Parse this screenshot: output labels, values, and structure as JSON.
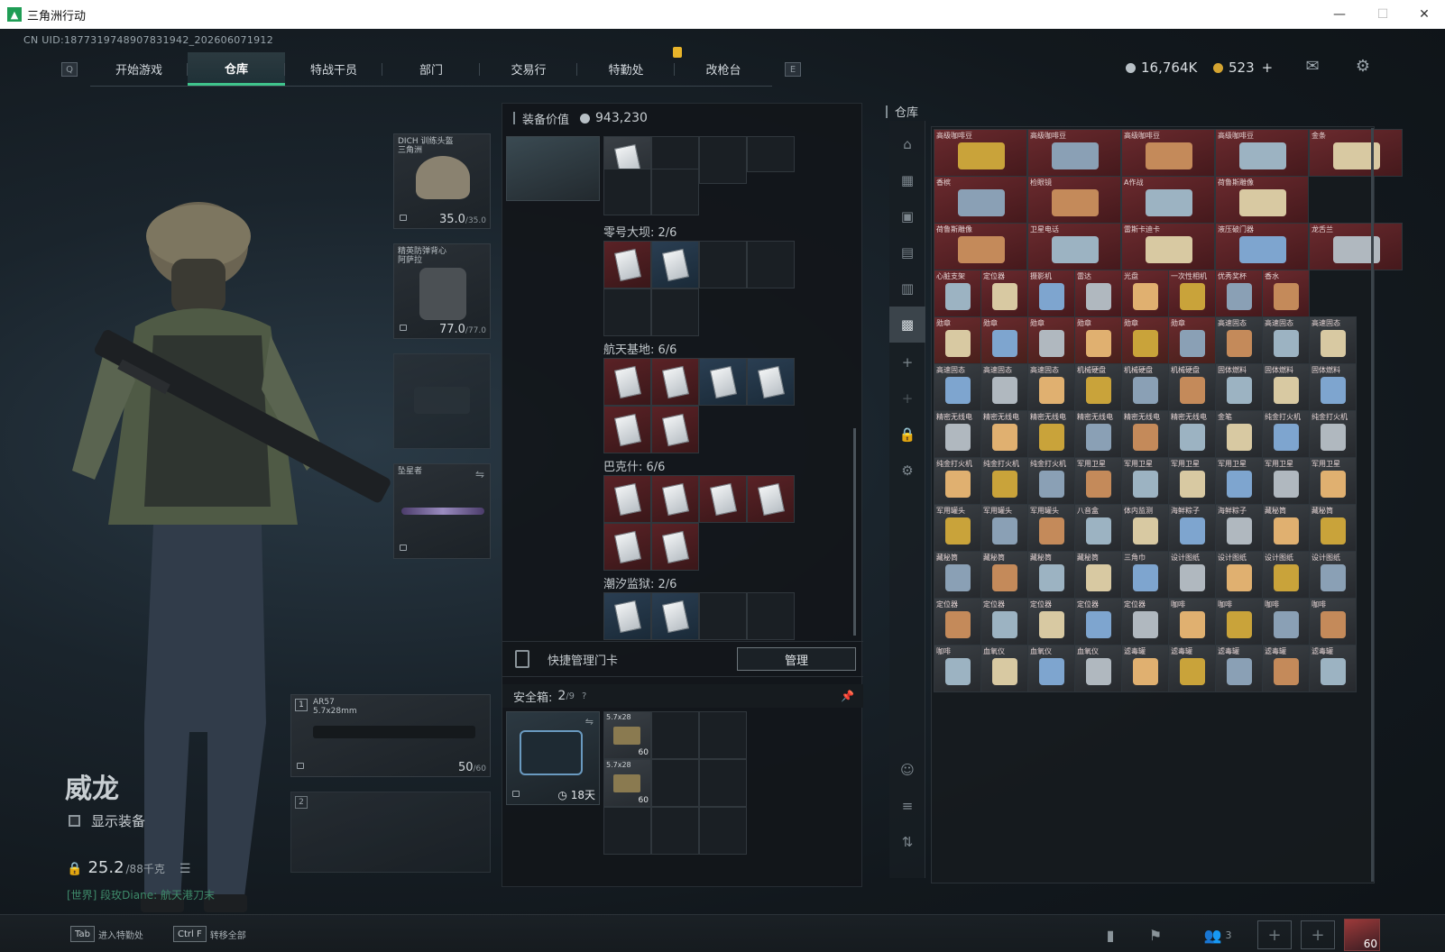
{
  "window": {
    "title": "三角洲行动",
    "controls": [
      "—",
      "☐",
      "✕"
    ]
  },
  "uid": "CN UID:1877319748907831942_202606071912",
  "nav": {
    "left_key": "Q",
    "right_key": "E",
    "tabs": [
      "开始游戏",
      "仓库",
      "特战干员",
      "部门",
      "交易行",
      "特勤处",
      "改枪台"
    ],
    "active_tab": "仓库"
  },
  "currency": {
    "silver": "16,764K",
    "gold": "523",
    "gold_plus": "+"
  },
  "character": {
    "name": "威龙",
    "show_equipment": "显示装备",
    "weight": "25.2",
    "weight_max": "/88千克",
    "chat": "[世界] 段玫Diane: 航天港刀末"
  },
  "equipment": {
    "helmet": {
      "label": "DICH 训练头盔\n三角洲",
      "durability": "35.0",
      "durability_max": "/35.0"
    },
    "armor": {
      "label": "精英防弹背心\n阿萨拉",
      "durability": "77.0",
      "durability_max": "/77.0"
    },
    "melee": {
      "label": "坠星者"
    },
    "primary": {
      "index": "1",
      "name": "AR57",
      "caliber": "5.7x28mm",
      "ammo": "50",
      "ammo_max": "/60"
    },
    "secondary": {
      "index": "2"
    }
  },
  "keycard_panel": {
    "title": "装备价值",
    "value": "943,230",
    "groups": [
      {
        "name": "零号大坝: 2/6"
      },
      {
        "name": "航天基地: 6/6"
      },
      {
        "name": "巴克什: 6/6"
      },
      {
        "name": "潮汐监狱: 2/6"
      }
    ],
    "quick_manage": "快捷管理门卡",
    "manage_button": "管理"
  },
  "safe_box": {
    "label": "安全箱:",
    "count": "2",
    "count_max": "/9",
    "help": "?",
    "timer": "18天",
    "ammo": [
      {
        "name": "5.7x28",
        "count": "60"
      },
      {
        "name": "5.7x28",
        "count": "60"
      }
    ]
  },
  "warehouse": {
    "title": "仓库",
    "rows": [
      [
        "高级咖啡豆",
        "高级咖啡豆",
        "高级咖啡豆",
        "高级咖啡豆",
        "金条"
      ],
      [
        "香槟",
        "检眼镜",
        "A作战",
        "荷鲁斯雕像"
      ],
      [
        "荷鲁斯雕像",
        "卫星电话",
        "雷斯卡迪卡",
        "液压破门器",
        "龙舌兰"
      ],
      [
        "心脏支架",
        "定位器",
        "摄影机",
        "雷达",
        "光盘",
        "一次性相机",
        "优秀奖杯",
        "香水"
      ],
      [
        "勋章",
        "勋章",
        "勋章",
        "勋章",
        "勋章",
        "勋章",
        "高速固态",
        "高速固态",
        "高速固态"
      ],
      [
        "高速固态",
        "高速固态",
        "高速固态",
        "机械硬盘",
        "机械硬盘",
        "机械硬盘",
        "固体燃料",
        "固体燃料",
        "固体燃料"
      ],
      [
        "精密无线电",
        "精密无线电",
        "精密无线电",
        "精密无线电",
        "精密无线电",
        "精密无线电",
        "金笔",
        "纯金打火机",
        "纯金打火机"
      ],
      [
        "纯金打火机",
        "纯金打火机",
        "纯金打火机",
        "军用卫星",
        "军用卫星",
        "军用卫星",
        "军用卫星",
        "军用卫星",
        "军用卫星"
      ],
      [
        "军用罐头",
        "军用罐头",
        "军用罐头",
        "八音盒",
        "体内监测",
        "海鲜粽子",
        "海鲜粽子",
        "藏秘筒",
        "藏秘筒"
      ],
      [
        "藏秘筒",
        "藏秘筒",
        "藏秘筒",
        "藏秘筒",
        "三角巾",
        "设计图纸",
        "设计图纸",
        "设计图纸",
        "设计图纸"
      ],
      [
        "定位器",
        "定位器",
        "定位器",
        "定位器",
        "定位器",
        "咖啡",
        "咖啡",
        "咖啡",
        "咖啡"
      ],
      [
        "咖啡",
        "血氧仪",
        "血氧仪",
        "血氧仪",
        "滤毒罐",
        "滤毒罐",
        "滤毒罐",
        "滤毒罐",
        "滤毒罐"
      ]
    ]
  },
  "bottom": {
    "hints": [
      {
        "key": "Tab",
        "label": "进入特勤处"
      },
      {
        "key": "Ctrl F",
        "label": "转移全部"
      }
    ],
    "party_count": "3",
    "level": "60"
  }
}
